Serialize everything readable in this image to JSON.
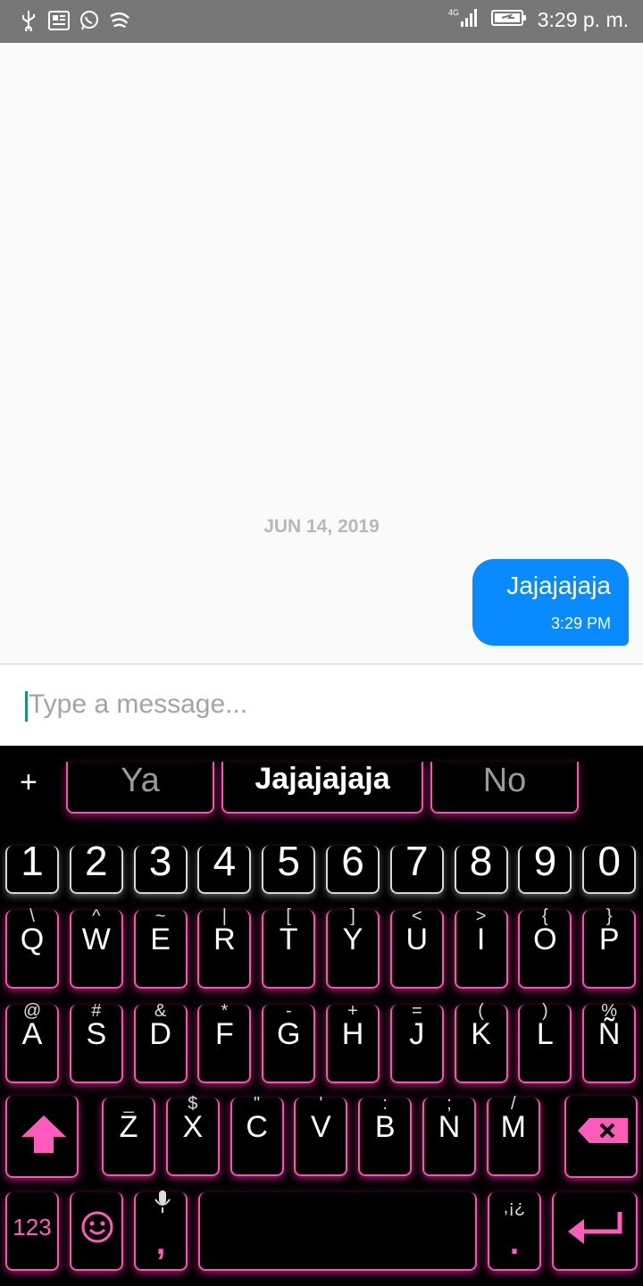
{
  "status_bar": {
    "time": "3:29 p. m.",
    "network": "4G",
    "left_icons": [
      "usb-icon",
      "news-icon",
      "whatsapp-icon",
      "swiftkey-icon"
    ]
  },
  "chat": {
    "date": "JUN 14, 2019",
    "messages": [
      {
        "text": "Jajajajaja",
        "time": "3:29 PM",
        "outgoing": true
      }
    ],
    "bubble_color": "#0a8aff"
  },
  "input": {
    "placeholder": "Type a message..."
  },
  "keyboard": {
    "accent_color": "#ff4fb2",
    "suggestions": [
      "Ya",
      "Jajajajaja",
      "No"
    ],
    "number_row": [
      "1",
      "2",
      "3",
      "4",
      "5",
      "6",
      "7",
      "8",
      "9",
      "0"
    ],
    "row1": {
      "keys": [
        "Q",
        "W",
        "E",
        "R",
        "T",
        "Y",
        "U",
        "I",
        "O",
        "P"
      ],
      "subs": [
        "\\",
        "^",
        "~",
        "|",
        "[",
        "]",
        "<",
        ">",
        "{",
        "}"
      ]
    },
    "row2": {
      "keys": [
        "A",
        "S",
        "D",
        "F",
        "G",
        "H",
        "J",
        "K",
        "L",
        "Ñ"
      ],
      "subs": [
        "@",
        "#",
        "&",
        "*",
        "-",
        "+",
        "=",
        "(",
        ")",
        "%"
      ]
    },
    "row3": {
      "keys": [
        "Z",
        "X",
        "C",
        "V",
        "B",
        "N",
        "M"
      ],
      "subs": [
        "_",
        "$",
        "\"",
        "'",
        ":",
        ";",
        "/"
      ]
    },
    "bottom": {
      "numbers_label": "123",
      "comma": ",",
      "period": ".",
      "period_sub": ",¡¿"
    }
  }
}
